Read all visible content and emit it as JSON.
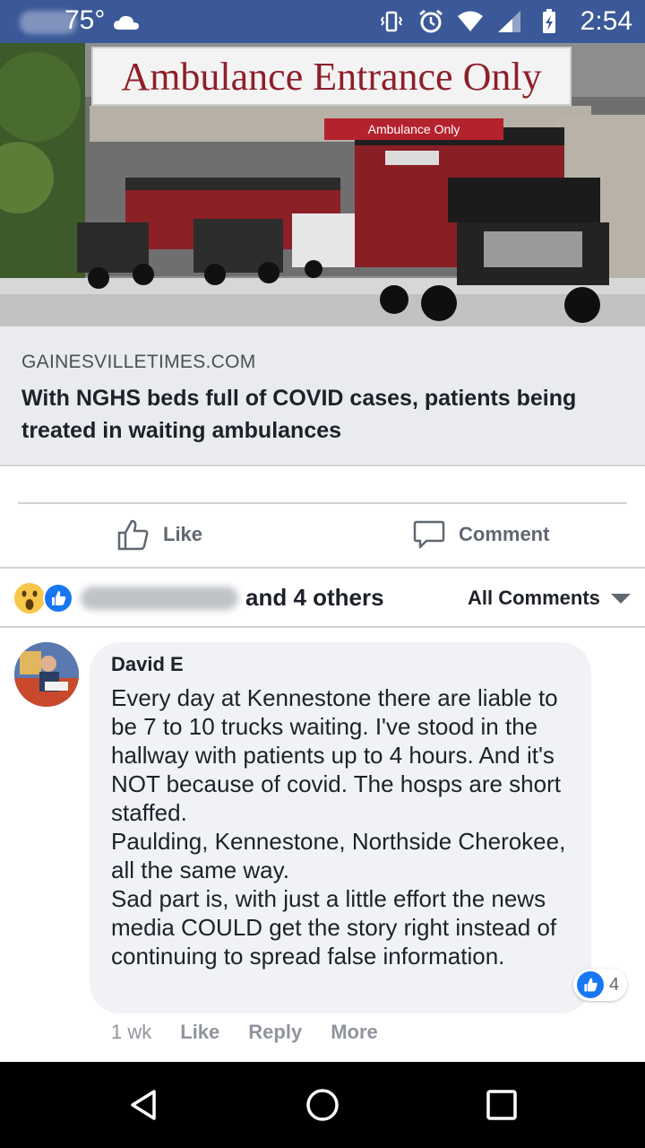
{
  "status_bar": {
    "temperature": "75°",
    "time": "2:54"
  },
  "hero": {
    "sign_text": "Ambulance Entrance Only",
    "sign_small_text": "Ambulance Only"
  },
  "link_preview": {
    "domain": "GAINESVILLETIMES.COM",
    "title": "With NGHS beds full of COVID cases, patients being treated in waiting ambulances"
  },
  "actions": {
    "like_label": "Like",
    "comment_label": "Comment"
  },
  "reactions": {
    "others_text": "and 4 others",
    "filter_label": "All Comments"
  },
  "comment": {
    "author": "David E",
    "text": "Every day at Kennestone there are liable to be 7 to 10 trucks waiting. I've stood in the hallway with patients up to 4 hours. And it's NOT because of covid. The hosps are short staffed.\nPaulding, Kennestone, Northside Cherokee, all the same way.\nSad part is, with just a little effort the news media COULD get the story right instead of continuing to spread false information.",
    "reaction_count": "4",
    "age": "1 wk",
    "like_label": "Like",
    "reply_label": "Reply",
    "more_label": "More"
  },
  "colors": {
    "status_bar": "#3b5998",
    "like_blue": "#1877f2",
    "bubble": "#f0f2f5",
    "card_bg": "#e9ebee"
  }
}
